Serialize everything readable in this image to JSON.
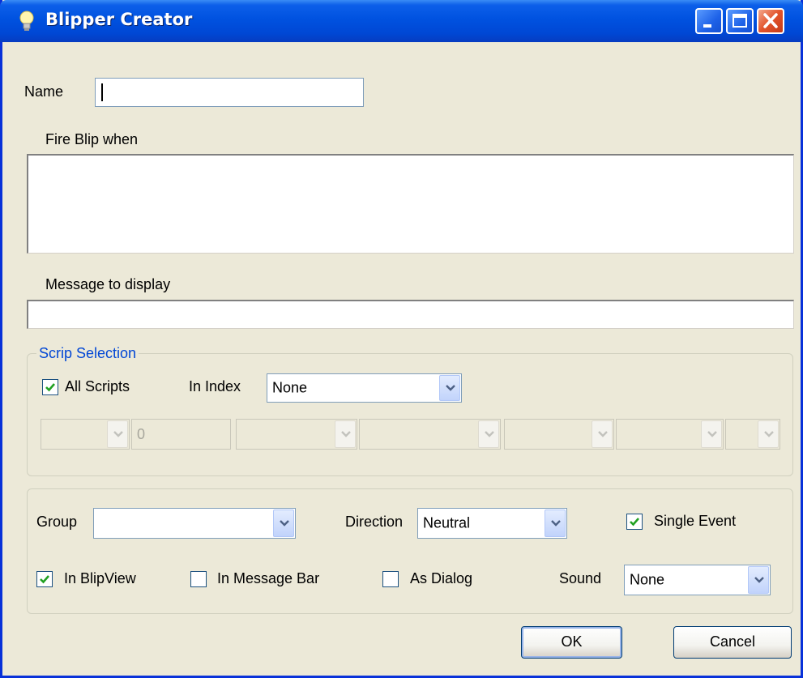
{
  "window": {
    "title": "Blipper Creator"
  },
  "form": {
    "name_label": "Name",
    "name_value": "",
    "fire_label": "Fire Blip when",
    "fire_value": "",
    "message_label": "Message to display",
    "message_value": ""
  },
  "scrip_selection": {
    "legend": "Scrip Selection",
    "all_scripts_label": "All Scripts",
    "all_scripts_checked": true,
    "in_index_label": "In Index",
    "in_index_value": "None",
    "numeric_field_value": "0"
  },
  "options": {
    "group_label": "Group",
    "group_value": "",
    "direction_label": "Direction",
    "direction_value": "Neutral",
    "single_event_label": "Single Event",
    "single_event_checked": true,
    "in_blipview_label": "In BlipView",
    "in_blipview_checked": true,
    "in_message_bar_label": "In Message Bar",
    "in_message_bar_checked": false,
    "as_dialog_label": "As Dialog",
    "as_dialog_checked": false,
    "sound_label": "Sound",
    "sound_value": "None"
  },
  "buttons": {
    "ok": "OK",
    "cancel": "Cancel"
  },
  "icons": {
    "app": "lightbulb-icon",
    "minimize": "minimize-icon",
    "maximize": "maximize-icon",
    "close": "close-icon",
    "dropdown": "chevron-down-icon",
    "check": "checkmark-icon"
  }
}
